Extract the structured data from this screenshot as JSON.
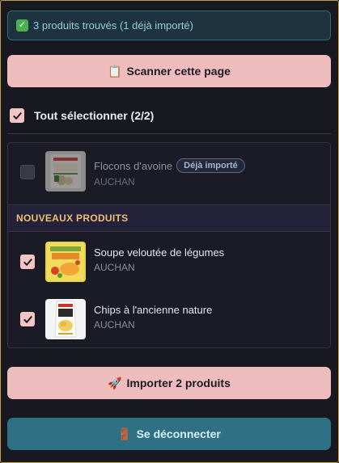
{
  "status": {
    "icon": "check-mark-icon",
    "text": "3 produits trouvés (1 déjà importé)"
  },
  "scan_button": {
    "icon": "clipboard-icon",
    "glyph": "📋",
    "label": "Scanner cette page"
  },
  "select_all": {
    "label": "Tout sélectionner (2/2)",
    "checked": true
  },
  "imported_products": [
    {
      "name": "Flocons d'avoine",
      "brand": "AUCHAN",
      "badge": "Déjà importé",
      "checked": false
    }
  ],
  "new_section": {
    "title": "NOUVEAUX PRODUITS"
  },
  "new_products": [
    {
      "name": "Soupe veloutée de légumes",
      "brand": "AUCHAN",
      "checked": true
    },
    {
      "name": "Chips à l'ancienne nature",
      "brand": "AUCHAN",
      "checked": true
    }
  ],
  "import_button": {
    "icon": "rocket-icon",
    "glyph": "🚀",
    "label": "Importer 2 produits"
  },
  "logout_button": {
    "icon": "door-icon",
    "glyph": "🚪",
    "label": "Se déconnecter"
  },
  "colors": {
    "accent_pink": "#eebcbd",
    "accent_teal": "#2f7085",
    "section_title": "#f0c070",
    "status_text": "#8fd0dc"
  }
}
